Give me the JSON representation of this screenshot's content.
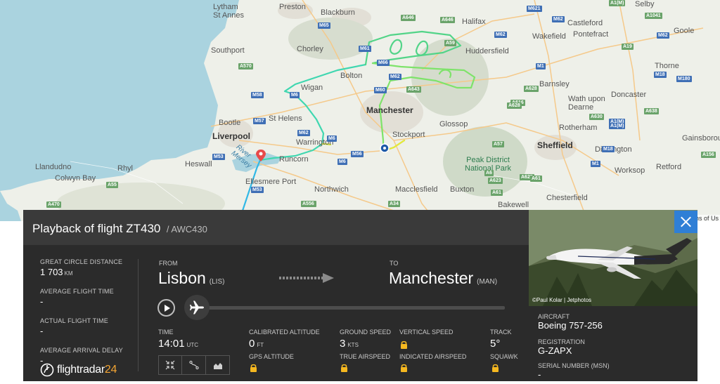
{
  "map": {
    "places": [
      {
        "name": "Lytham\nSt Annes"
      },
      {
        "name": "Preston"
      },
      {
        "name": "Blackburn"
      },
      {
        "name": "Halifax"
      },
      {
        "name": "Wakefield"
      },
      {
        "name": "Castleford"
      },
      {
        "name": "Pontefract"
      },
      {
        "name": "Goole"
      },
      {
        "name": "Selby"
      },
      {
        "name": "Southport"
      },
      {
        "name": "Chorley"
      },
      {
        "name": "Huddersfield"
      },
      {
        "name": "Barnsley"
      },
      {
        "name": "Thorne"
      },
      {
        "name": "Bolton"
      },
      {
        "name": "Wigan"
      },
      {
        "name": "Doncaster"
      },
      {
        "name": "Wath upon\nDearne"
      },
      {
        "name": "Manchester"
      },
      {
        "name": "Bootle"
      },
      {
        "name": "St Helens"
      },
      {
        "name": "Liverpool"
      },
      {
        "name": "Stockport"
      },
      {
        "name": "Glossop"
      },
      {
        "name": "Rotherham"
      },
      {
        "name": "Warrington"
      },
      {
        "name": "Gainsborough"
      },
      {
        "name": "Sheffield"
      },
      {
        "name": "Dinnington"
      },
      {
        "name": "Heswall"
      },
      {
        "name": "Runcorn"
      },
      {
        "name": "Llandudno"
      },
      {
        "name": "Rhyl"
      },
      {
        "name": "Colwyn Bay"
      },
      {
        "name": "Peak District\nNational Park"
      },
      {
        "name": "Worksop"
      },
      {
        "name": "Retford"
      },
      {
        "name": "Ellesmere Port"
      },
      {
        "name": "Northwich"
      },
      {
        "name": "Macclesfield"
      },
      {
        "name": "Buxton"
      },
      {
        "name": "Chesterfield"
      },
      {
        "name": "Bakewell"
      },
      {
        "name": "River\nMersey"
      }
    ],
    "roads": [
      "A1(M)",
      "A646",
      "A646",
      "M621",
      "M62",
      "A1041",
      "M65",
      "M62",
      "A59",
      "M62",
      "A19",
      "A570",
      "M61",
      "M1",
      "M18",
      "M180",
      "M66",
      "M58",
      "M6",
      "M62",
      "A643",
      "A628",
      "M60",
      "M57",
      "A616",
      "A630",
      "M62",
      "A638",
      "A1(M)",
      "A628",
      "A1(M)",
      "M6",
      "M53",
      "M56",
      "A57",
      "M18",
      "A156",
      "A55",
      "M6",
      "A556",
      "A6",
      "A623",
      "A625",
      "M1",
      "A470",
      "M53",
      "A556",
      "A34",
      "A61",
      "A61",
      "A619"
    ],
    "attribution": "ms of Us"
  },
  "flight": {
    "title": "Playback of flight ZT430",
    "subtitle": "/ AWC430",
    "great_circle_label": "GREAT CIRCLE DISTANCE",
    "great_circle_value": "1 703",
    "great_circle_unit": "KM",
    "avg_flight_time_label": "AVERAGE FLIGHT TIME",
    "avg_flight_time_value": "-",
    "actual_flight_time_label": "ACTUAL FLIGHT TIME",
    "actual_flight_time_value": "-",
    "avg_arrival_delay_label": "AVERAGE ARRIVAL DELAY",
    "avg_arrival_delay_value": "-",
    "from_label": "FROM",
    "from_city": "Lisbon",
    "from_code": "(LIS)",
    "to_label": "TO",
    "to_city": "Manchester",
    "to_code": "(MAN)",
    "playback_progress": 0.0,
    "time_label": "TIME",
    "time_value": "14:01",
    "time_unit": "UTC",
    "cal_alt_label": "CALIBRATED ALTITUDE",
    "cal_alt_value": "0",
    "cal_alt_unit": "FT",
    "gps_alt_label": "GPS ALTITUDE",
    "ground_speed_label": "GROUND SPEED",
    "ground_speed_value": "3",
    "ground_speed_unit": "KTS",
    "true_airspeed_label": "TRUE AIRSPEED",
    "vertical_speed_label": "VERTICAL SPEED",
    "indicated_airspeed_label": "INDICATED AIRSPEED",
    "track_label": "TRACK",
    "track_value": "5°",
    "squawk_label": "SQUAWK",
    "logo_text": "flightradar",
    "logo_num": "24"
  },
  "aircraft": {
    "photo_credit": "©Paul Kolar | Jetphotos",
    "aircraft_label": "AIRCRAFT",
    "aircraft_value": "Boeing 757-256",
    "registration_label": "REGISTRATION",
    "registration_value": "G-ZAPX",
    "serial_label": "SERIAL NUMBER (MSN)",
    "serial_value": "-"
  },
  "icons": [
    "close-icon",
    "play-icon",
    "plane-icon",
    "lock-icon",
    "zoom-fit-icon",
    "route-icon",
    "altitude-graph-icon",
    "origin-pin-icon",
    "aircraft-position-icon"
  ],
  "colors": {
    "accent": "#2f7fd6",
    "logo_accent": "#f4a533",
    "lock": "#f5b820",
    "panel": "#2b2b2b"
  }
}
